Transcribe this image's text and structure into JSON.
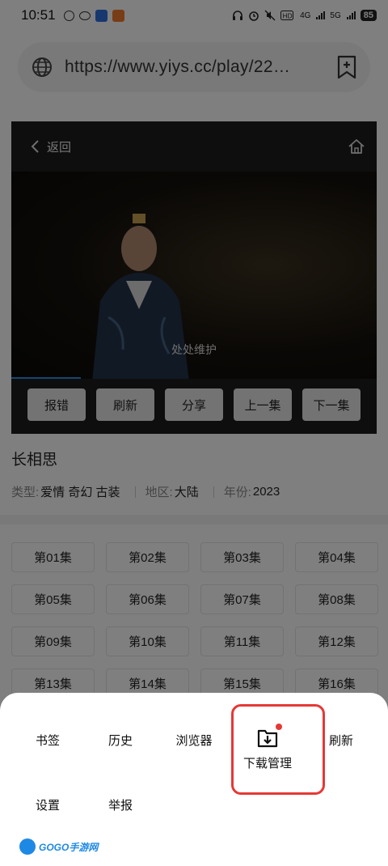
{
  "status_bar": {
    "time": "10:51",
    "network_1": "4G",
    "network_2": "5G",
    "battery": "85"
  },
  "address_bar": {
    "url": "https://www.yiys.cc/play/22…"
  },
  "player": {
    "back_label": "返回",
    "video_caption": "处处维护",
    "progress": 0.19,
    "buttons": [
      "报错",
      "刷新",
      "分享",
      "上一集",
      "下一集"
    ]
  },
  "show": {
    "title": "长相思",
    "type_label": "类型:",
    "type_values": "爱情 奇幻 古装",
    "region_label": "地区:",
    "region_value": "大陆",
    "year_label": "年份:",
    "year_value": "2023"
  },
  "episodes": [
    "第01集",
    "第02集",
    "第03集",
    "第04集",
    "第05集",
    "第06集",
    "第07集",
    "第08集",
    "第09集",
    "第10集",
    "第11集",
    "第12集",
    "第13集",
    "第14集",
    "第15集",
    "第16集"
  ],
  "menu": {
    "items": [
      {
        "label": "书签",
        "icon": "bookmark-icon"
      },
      {
        "label": "历史",
        "icon": "clock-icon"
      },
      {
        "label": "浏览器",
        "icon": "globe-icon"
      },
      {
        "label": "下载管理",
        "icon": "download-folder-icon"
      },
      {
        "label": "刷新",
        "icon": "refresh-icon"
      },
      {
        "label": "设置",
        "icon": "gear-icon"
      },
      {
        "label": "举报",
        "icon": "warning-icon"
      }
    ]
  },
  "watermark": "GOGO手游网",
  "colors": {
    "accent_progress": "#2a8fe0",
    "highlight": "#e53935"
  }
}
